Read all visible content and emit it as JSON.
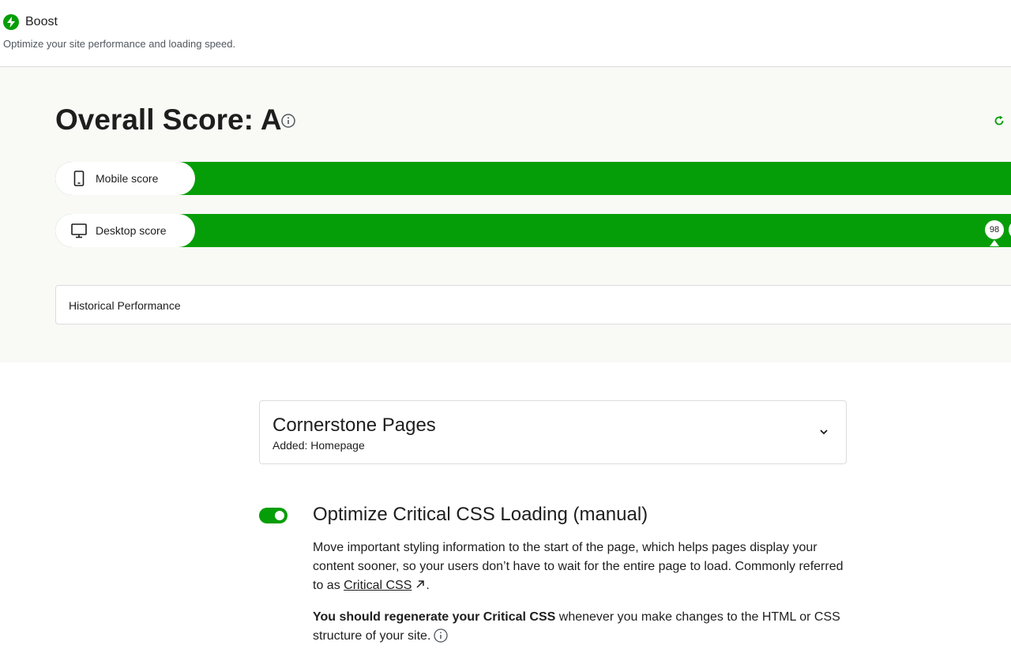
{
  "header": {
    "title": "Boost",
    "subtitle": "Optimize your site performance and loading speed."
  },
  "score": {
    "title": "Overall Score: A",
    "bars": [
      {
        "label": "Mobile score",
        "icon": "mobile-icon"
      },
      {
        "label": "Desktop score",
        "icon": "desktop-icon",
        "badge": "98"
      }
    ]
  },
  "history": {
    "title": "Historical Performance"
  },
  "cornerstone": {
    "title": "Cornerstone Pages",
    "subtitle": "Added: Homepage"
  },
  "module": {
    "title": "Optimize Critical CSS Loading (manual)",
    "enabled": true,
    "description_before": "Move important styling information to the start of the page, which helps pages display your content sooner, so your users don’t have to wait for the entire page to load. Commonly referred to as ",
    "description_link": "Critical CSS",
    "description_after": ".",
    "note_bold": "You should regenerate your Critical CSS",
    "note_rest": " whenever you make changes to the HTML or CSS structure of your site."
  },
  "colors": {
    "accent": "#069e08",
    "section_background": "#f9f9f6",
    "border": "#dcdcde"
  }
}
